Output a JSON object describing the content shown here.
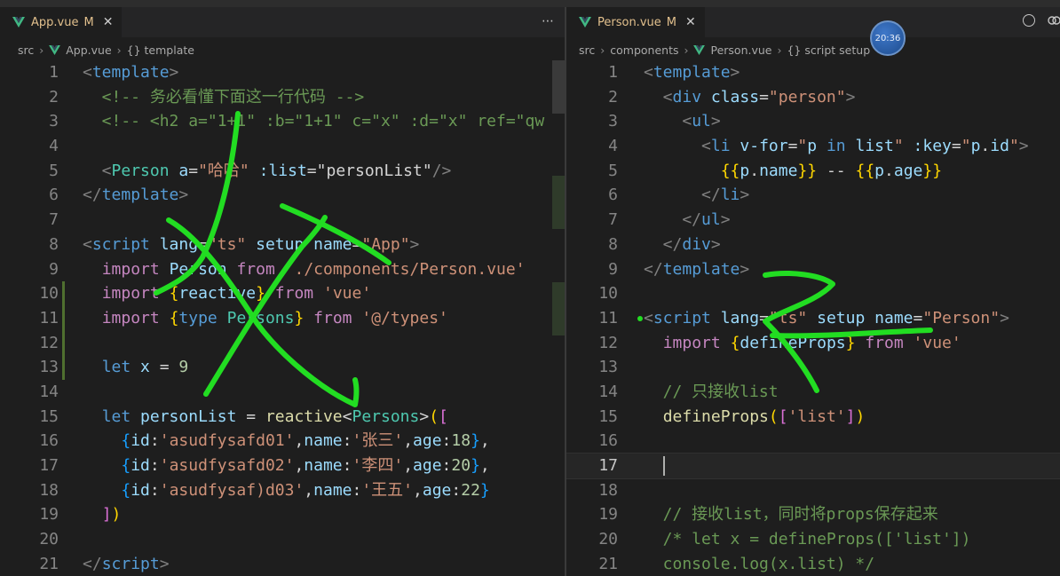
{
  "left": {
    "tab": {
      "filename": "App.vue",
      "status": "M",
      "close": "✕"
    },
    "more_icon": "⋯",
    "breadcrumb": [
      "src",
      "App.vue",
      "{} template"
    ],
    "lines": [
      {
        "n": "1",
        "tokens": [
          [
            "<",
            "br"
          ],
          [
            "template",
            "tag"
          ],
          [
            ">",
            "br"
          ]
        ]
      },
      {
        "n": "2",
        "tokens": [
          [
            "  <!-- 务必看懂下面这一行代码 -->",
            "cmt"
          ]
        ]
      },
      {
        "n": "3",
        "tokens": [
          [
            "  <!-- <h2 a=\"1+1\" :b=\"1+1\" c=\"x\" :d=\"x\" ref=\"qw",
            "cmt"
          ]
        ]
      },
      {
        "n": "4",
        "tokens": []
      },
      {
        "n": "5",
        "tokens": [
          [
            "  <",
            "br"
          ],
          [
            "Person",
            "type"
          ],
          [
            " ",
            "plain"
          ],
          [
            "a",
            "attr"
          ],
          [
            "=",
            "plain"
          ],
          [
            "\"哈哈\"",
            "str"
          ],
          [
            " ",
            "plain"
          ],
          [
            ":list",
            "attr"
          ],
          [
            "=",
            "plain"
          ],
          [
            "\"personList\"",
            "plain"
          ],
          [
            "/>",
            "br"
          ]
        ]
      },
      {
        "n": "6",
        "tokens": [
          [
            "</",
            "br"
          ],
          [
            "template",
            "tag"
          ],
          [
            ">",
            "br"
          ]
        ]
      },
      {
        "n": "7",
        "tokens": []
      },
      {
        "n": "8",
        "tokens": [
          [
            "<",
            "br"
          ],
          [
            "script",
            "tag"
          ],
          [
            " ",
            "plain"
          ],
          [
            "lang",
            "attr"
          ],
          [
            "=",
            "plain"
          ],
          [
            "\"ts\"",
            "str"
          ],
          [
            " ",
            "plain"
          ],
          [
            "setup",
            "attr"
          ],
          [
            " ",
            "plain"
          ],
          [
            "name",
            "attr"
          ],
          [
            "=",
            "plain"
          ],
          [
            "\"App\"",
            "str"
          ],
          [
            ">",
            "br"
          ]
        ]
      },
      {
        "n": "9",
        "tokens": [
          [
            "  ",
            "plain"
          ],
          [
            "import",
            "kw"
          ],
          [
            " ",
            "plain"
          ],
          [
            "Person",
            "var"
          ],
          [
            " ",
            "plain"
          ],
          [
            "from",
            "kw"
          ],
          [
            " ",
            "plain"
          ],
          [
            "'./components/Person.vue'",
            "str"
          ]
        ]
      },
      {
        "n": "10",
        "tokens": [
          [
            "  ",
            "plain"
          ],
          [
            "import",
            "kw"
          ],
          [
            " ",
            "plain"
          ],
          [
            "{",
            "gold"
          ],
          [
            "reactive",
            "var"
          ],
          [
            "}",
            "gold"
          ],
          [
            " ",
            "plain"
          ],
          [
            "from",
            "kw"
          ],
          [
            " ",
            "plain"
          ],
          [
            "'vue'",
            "str"
          ]
        ]
      },
      {
        "n": "11",
        "tokens": [
          [
            "  ",
            "plain"
          ],
          [
            "import",
            "kw"
          ],
          [
            " ",
            "plain"
          ],
          [
            "{",
            "gold"
          ],
          [
            "type",
            "kw2"
          ],
          [
            " ",
            "plain"
          ],
          [
            "Persons",
            "type"
          ],
          [
            "}",
            "gold"
          ],
          [
            " ",
            "plain"
          ],
          [
            "from",
            "kw"
          ],
          [
            " ",
            "plain"
          ],
          [
            "'@/types'",
            "str"
          ]
        ]
      },
      {
        "n": "12",
        "tokens": []
      },
      {
        "n": "13",
        "tokens": [
          [
            "  ",
            "plain"
          ],
          [
            "let",
            "kw2"
          ],
          [
            " ",
            "plain"
          ],
          [
            "x",
            "var"
          ],
          [
            " = ",
            "plain"
          ],
          [
            "9",
            "num"
          ]
        ]
      },
      {
        "n": "14",
        "tokens": []
      },
      {
        "n": "15",
        "tokens": [
          [
            "  ",
            "plain"
          ],
          [
            "let",
            "kw2"
          ],
          [
            " ",
            "plain"
          ],
          [
            "personList",
            "var"
          ],
          [
            " = ",
            "plain"
          ],
          [
            "reactive",
            "fn"
          ],
          [
            "<",
            "plain"
          ],
          [
            "Persons",
            "type"
          ],
          [
            ">",
            "plain"
          ],
          [
            "(",
            "gold"
          ],
          [
            "[",
            "pink"
          ]
        ]
      },
      {
        "n": "16",
        "tokens": [
          [
            "    ",
            "plain"
          ],
          [
            "{",
            "sky"
          ],
          [
            "id",
            "var"
          ],
          [
            ":",
            "plain"
          ],
          [
            "'asudfysafd01'",
            "str"
          ],
          [
            ",",
            "plain"
          ],
          [
            "name",
            "var"
          ],
          [
            ":",
            "plain"
          ],
          [
            "'张三'",
            "str"
          ],
          [
            ",",
            "plain"
          ],
          [
            "age",
            "var"
          ],
          [
            ":",
            "plain"
          ],
          [
            "18",
            "num"
          ],
          [
            "}",
            "sky"
          ],
          [
            ",",
            "plain"
          ]
        ]
      },
      {
        "n": "17",
        "tokens": [
          [
            "    ",
            "plain"
          ],
          [
            "{",
            "sky"
          ],
          [
            "id",
            "var"
          ],
          [
            ":",
            "plain"
          ],
          [
            "'asudfysafd02'",
            "str"
          ],
          [
            ",",
            "plain"
          ],
          [
            "name",
            "var"
          ],
          [
            ":",
            "plain"
          ],
          [
            "'李四'",
            "str"
          ],
          [
            ",",
            "plain"
          ],
          [
            "age",
            "var"
          ],
          [
            ":",
            "plain"
          ],
          [
            "20",
            "num"
          ],
          [
            "}",
            "sky"
          ],
          [
            ",",
            "plain"
          ]
        ]
      },
      {
        "n": "18",
        "tokens": [
          [
            "    ",
            "plain"
          ],
          [
            "{",
            "sky"
          ],
          [
            "id",
            "var"
          ],
          [
            ":",
            "plain"
          ],
          [
            "'asudfysaf)d03'",
            "str"
          ],
          [
            ",",
            "plain"
          ],
          [
            "name",
            "var"
          ],
          [
            ":",
            "plain"
          ],
          [
            "'王五'",
            "str"
          ],
          [
            ",",
            "plain"
          ],
          [
            "age",
            "var"
          ],
          [
            ":",
            "plain"
          ],
          [
            "22",
            "num"
          ],
          [
            "}",
            "sky"
          ]
        ]
      },
      {
        "n": "19",
        "tokens": [
          [
            "  ",
            "plain"
          ],
          [
            "]",
            "pink"
          ],
          [
            ")",
            "gold"
          ]
        ]
      },
      {
        "n": "20",
        "tokens": []
      },
      {
        "n": "21",
        "tokens": [
          [
            "</",
            "br"
          ],
          [
            "script",
            "tag"
          ],
          [
            ">",
            "br"
          ]
        ]
      }
    ]
  },
  "right": {
    "tab": {
      "filename": "Person.vue",
      "status": "M",
      "close": "✕"
    },
    "timer_badge": "20:36",
    "breadcrumb": [
      "src",
      "components",
      "Person.vue",
      "{} script setup"
    ],
    "current_line": "17",
    "lines": [
      {
        "n": "1",
        "tokens": [
          [
            "<",
            "br"
          ],
          [
            "template",
            "tag"
          ],
          [
            ">",
            "br"
          ]
        ]
      },
      {
        "n": "2",
        "tokens": [
          [
            "  <",
            "br"
          ],
          [
            "div",
            "tag"
          ],
          [
            " ",
            "plain"
          ],
          [
            "class",
            "attr"
          ],
          [
            "=",
            "plain"
          ],
          [
            "\"person\"",
            "str"
          ],
          [
            ">",
            "br"
          ]
        ]
      },
      {
        "n": "3",
        "tokens": [
          [
            "    <",
            "br"
          ],
          [
            "ul",
            "tag"
          ],
          [
            ">",
            "br"
          ]
        ]
      },
      {
        "n": "4",
        "tokens": [
          [
            "      <",
            "br"
          ],
          [
            "li",
            "tag"
          ],
          [
            " ",
            "plain"
          ],
          [
            "v-for",
            "attr"
          ],
          [
            "=",
            "plain"
          ],
          [
            "\"",
            "str"
          ],
          [
            "p",
            "var"
          ],
          [
            " ",
            "plain"
          ],
          [
            "in",
            "kw2"
          ],
          [
            " ",
            "plain"
          ],
          [
            "list",
            "var"
          ],
          [
            "\"",
            "str"
          ],
          [
            " ",
            "plain"
          ],
          [
            ":key",
            "attr"
          ],
          [
            "=",
            "plain"
          ],
          [
            "\"",
            "str"
          ],
          [
            "p",
            "var"
          ],
          [
            ".",
            "plain"
          ],
          [
            "id",
            "var"
          ],
          [
            "\"",
            "str"
          ],
          [
            ">",
            "br"
          ]
        ]
      },
      {
        "n": "5",
        "tokens": [
          [
            "        ",
            "plain"
          ],
          [
            "{{",
            "gold"
          ],
          [
            "p",
            "var"
          ],
          [
            ".",
            "plain"
          ],
          [
            "name",
            "var"
          ],
          [
            "}}",
            "gold"
          ],
          [
            " -- ",
            "plain"
          ],
          [
            "{{",
            "gold"
          ],
          [
            "p",
            "var"
          ],
          [
            ".",
            "plain"
          ],
          [
            "age",
            "var"
          ],
          [
            "}}",
            "gold"
          ]
        ]
      },
      {
        "n": "6",
        "tokens": [
          [
            "      </",
            "br"
          ],
          [
            "li",
            "tag"
          ],
          [
            ">",
            "br"
          ]
        ]
      },
      {
        "n": "7",
        "tokens": [
          [
            "    </",
            "br"
          ],
          [
            "ul",
            "tag"
          ],
          [
            ">",
            "br"
          ]
        ]
      },
      {
        "n": "8",
        "tokens": [
          [
            "  </",
            "br"
          ],
          [
            "div",
            "tag"
          ],
          [
            ">",
            "br"
          ]
        ]
      },
      {
        "n": "9",
        "tokens": [
          [
            "</",
            "br"
          ],
          [
            "template",
            "tag"
          ],
          [
            ">",
            "br"
          ]
        ]
      },
      {
        "n": "10",
        "tokens": []
      },
      {
        "n": "11",
        "tokens": [
          [
            "<",
            "br"
          ],
          [
            "script",
            "tag"
          ],
          [
            " ",
            "plain"
          ],
          [
            "lang",
            "attr"
          ],
          [
            "=",
            "plain"
          ],
          [
            "\"ts\"",
            "str"
          ],
          [
            " ",
            "plain"
          ],
          [
            "setup",
            "attr"
          ],
          [
            " ",
            "plain"
          ],
          [
            "name",
            "attr"
          ],
          [
            "=",
            "plain"
          ],
          [
            "\"Person\"",
            "str"
          ],
          [
            ">",
            "br"
          ]
        ]
      },
      {
        "n": "12",
        "tokens": [
          [
            "  ",
            "plain"
          ],
          [
            "import",
            "kw"
          ],
          [
            " ",
            "plain"
          ],
          [
            "{",
            "gold"
          ],
          [
            "defineProps",
            "var"
          ],
          [
            "}",
            "gold"
          ],
          [
            " ",
            "plain"
          ],
          [
            "from",
            "kw"
          ],
          [
            " ",
            "plain"
          ],
          [
            "'vue'",
            "str"
          ]
        ]
      },
      {
        "n": "13",
        "tokens": []
      },
      {
        "n": "14",
        "tokens": [
          [
            "  // 只接收list",
            "cmt"
          ]
        ]
      },
      {
        "n": "15",
        "tokens": [
          [
            "  ",
            "plain"
          ],
          [
            "defineProps",
            "fn"
          ],
          [
            "(",
            "gold"
          ],
          [
            "[",
            "pink"
          ],
          [
            "'list'",
            "str"
          ],
          [
            "]",
            "pink"
          ],
          [
            ")",
            "gold"
          ]
        ]
      },
      {
        "n": "16",
        "tokens": []
      },
      {
        "n": "17",
        "tokens": []
      },
      {
        "n": "18",
        "tokens": []
      },
      {
        "n": "19",
        "tokens": [
          [
            "  // 接收list，同时将props保存起来",
            "cmt"
          ]
        ]
      },
      {
        "n": "20",
        "tokens": [
          [
            "  /* let x = defineProps(['list'])",
            "cmt"
          ]
        ]
      },
      {
        "n": "21",
        "tokens": [
          [
            "  console.log(x.list) */",
            "cmt"
          ]
        ]
      }
    ]
  },
  "colors": {
    "annotation_ink": "#22dd22",
    "modified_tab": "#e2c08d"
  }
}
